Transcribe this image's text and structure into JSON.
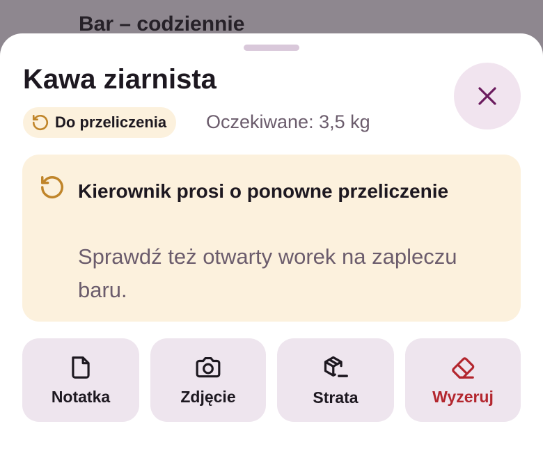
{
  "backdrop": {
    "title": "Bar – codziennie"
  },
  "sheet": {
    "title": "Kawa ziarnista",
    "close_icon": "close-icon",
    "status_badge": {
      "label": "Do przeliczenia",
      "icon": "recount-icon"
    },
    "expected": "Oczekiwane: 3,5 kg",
    "notice": {
      "icon": "recount-icon",
      "title": "Kierownik prosi o ponowne przeliczenie",
      "text": "Sprawdź też otwarty worek na zapleczu baru."
    },
    "actions": [
      {
        "label": "Notatka",
        "icon": "note-icon"
      },
      {
        "label": "Zdjęcie",
        "icon": "camera-icon"
      },
      {
        "label": "Strata",
        "icon": "package-loss-icon"
      },
      {
        "label": "Wyzeruj",
        "icon": "eraser-icon"
      }
    ]
  },
  "colors": {
    "accent": "#6b1b5e",
    "warning": "#c0852a",
    "danger": "#b3262e",
    "notice_background": "#fcf1dd",
    "button_background": "#eee5ee"
  }
}
